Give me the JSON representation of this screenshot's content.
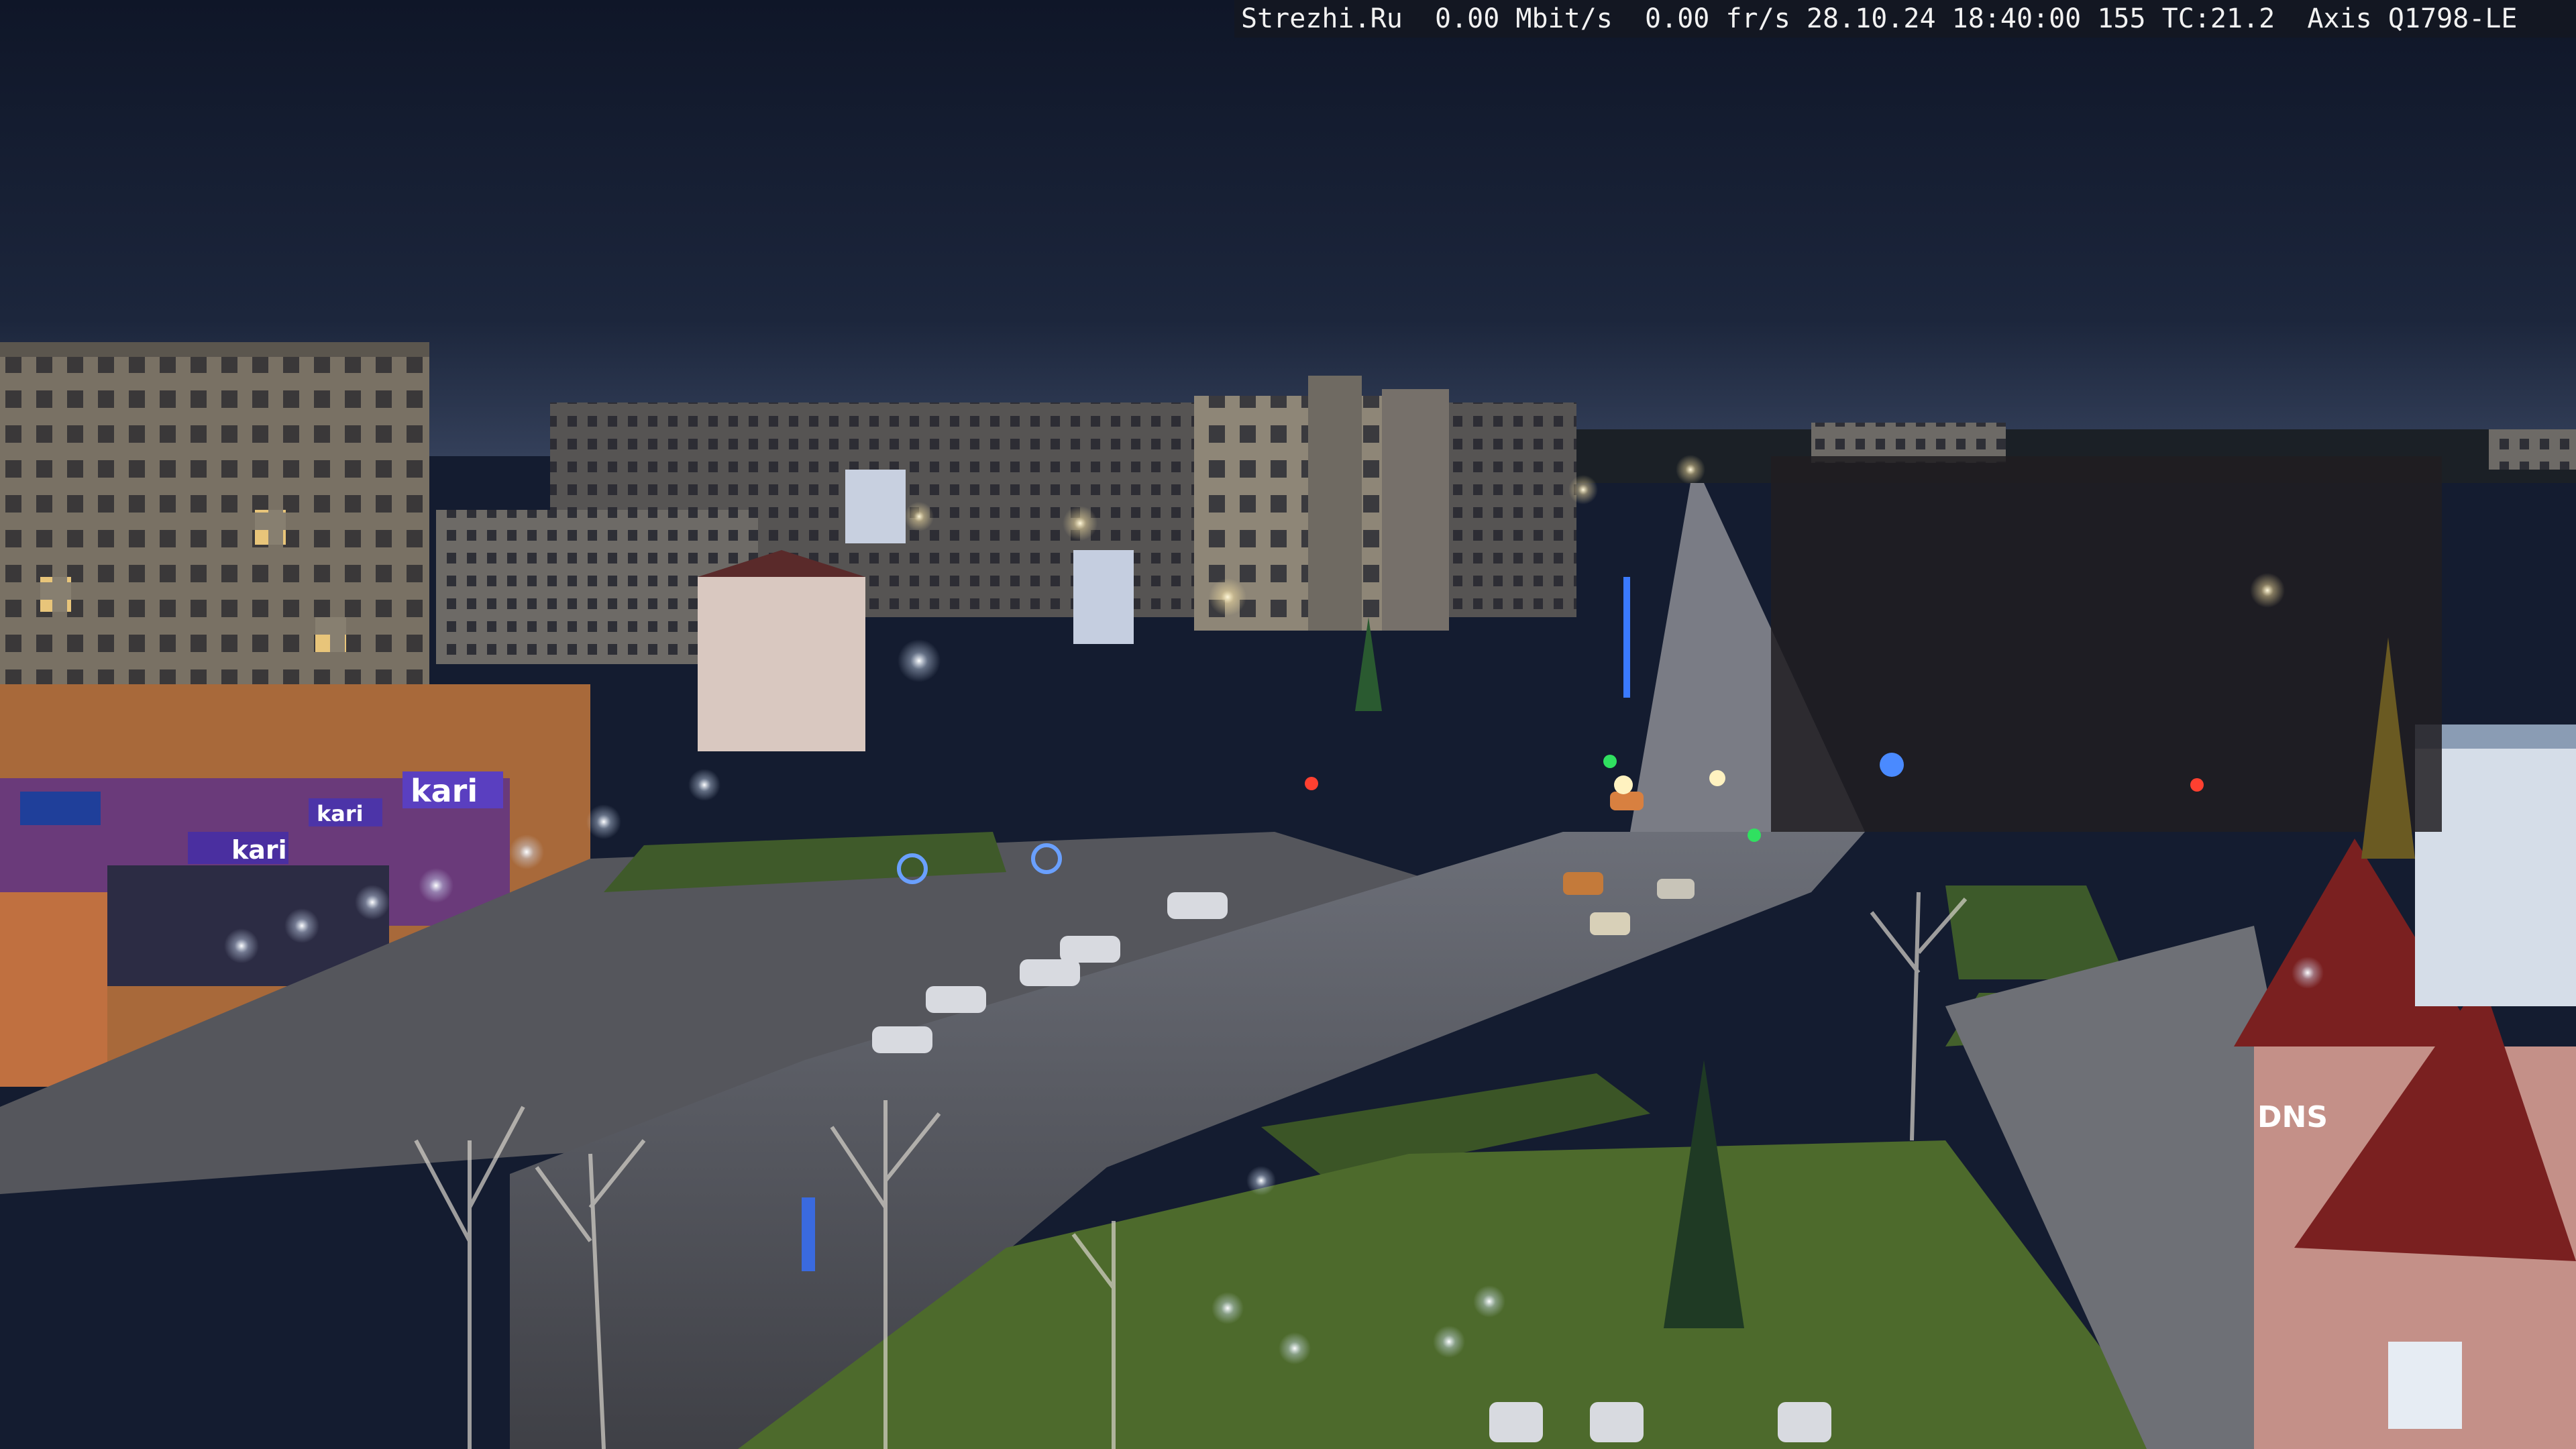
{
  "camera_overlay": {
    "text": "Strezhi.Ru  0.00 Mbit/s  0.00 fr/s 28.10.24 18:40:00 155 TC:21.2  Axis Q1798-LE"
  },
  "storefront_signs": {
    "brand_main": "kari",
    "brand_lower": "kari",
    "brand_side": "kari",
    "store_right": "DNS"
  },
  "colors": {
    "sky_top": "#101829",
    "sky_horizon": "#2e3a50",
    "street_light": "#fff4d0",
    "kari_sign": "#5a3fc0",
    "grass": "#4d6a2c"
  }
}
